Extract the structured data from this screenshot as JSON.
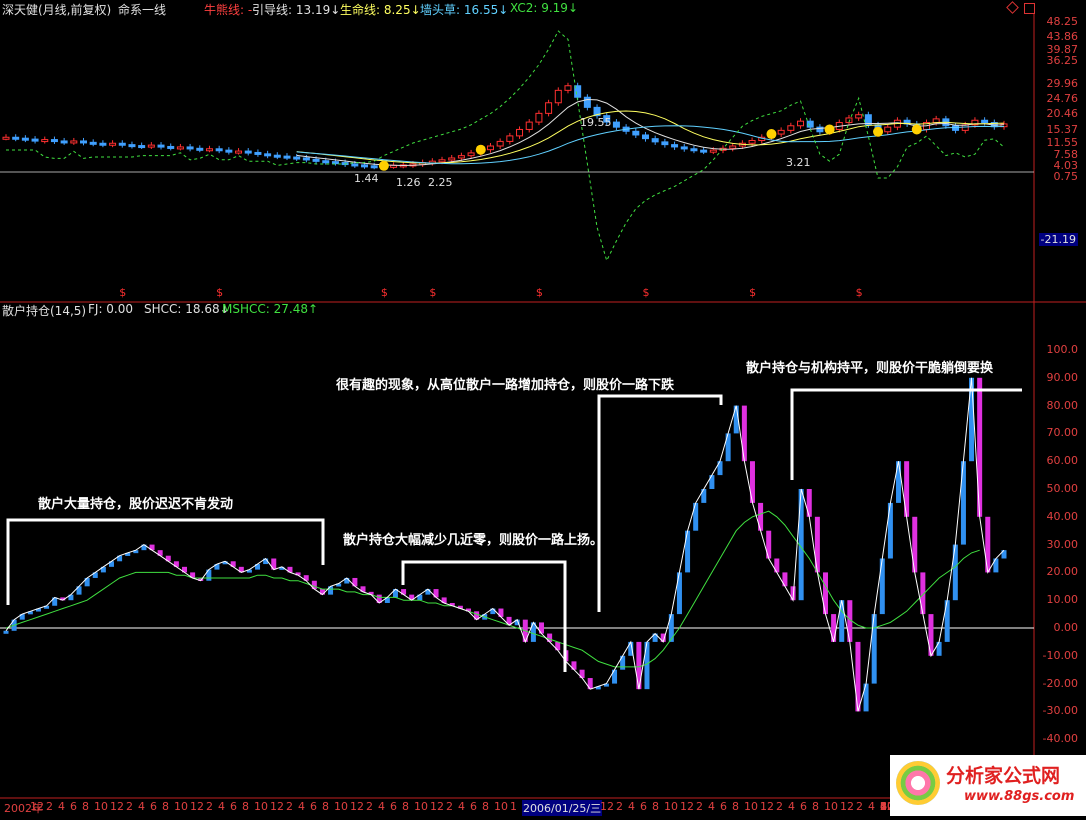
{
  "upper_header": {
    "stock": "深天健(月线,前复权)",
    "system": "命系一线",
    "items": [
      {
        "label": "牛熊线: -",
        "color": "#ff4040"
      },
      {
        "label": "引导线: 13.19↓",
        "color": "#e0e0e0"
      },
      {
        "label": "生命线: 8.25↓",
        "color": "#ffff60"
      },
      {
        "label": "墙头草: 16.55↓",
        "color": "#60d0ff"
      },
      {
        "label": "XC2: 9.19↓",
        "color": "#40e040"
      }
    ]
  },
  "lower_header": {
    "items": [
      {
        "label": "散户持仓(14,5)",
        "color": "#e0e0e0"
      },
      {
        "label": "FJ: 0.00",
        "color": "#e0e0e0"
      },
      {
        "label": "SHCC: 18.68↓",
        "color": "#e0e0e0"
      },
      {
        "label": "MSHCC: 27.48↑",
        "color": "#40e040"
      }
    ]
  },
  "annotations": [
    {
      "text": "散户大量持仓，股价迟迟不肯发动"
    },
    {
      "text": "散户持仓大幅减少几近零，则股价一路上扬。"
    },
    {
      "text": "很有趣的现象，从高位散户一路增加持仓，则股价一路下跌"
    },
    {
      "text": "散户持仓与机构持平，则股价干脆躺倒要换"
    }
  ],
  "x_axis": {
    "labels": [
      "2002年",
      "12",
      "2",
      "4",
      "6",
      "8",
      "10",
      "12",
      "2",
      "4",
      "6",
      "8",
      "10",
      "12",
      "2",
      "4",
      "6",
      "8",
      "10",
      "12",
      "2",
      "4",
      "6",
      "8",
      "10",
      "12",
      "2",
      "4",
      "6",
      "8",
      "10",
      "12",
      "2",
      "4",
      "6",
      "8",
      "10",
      "1",
      "2006/01/25/三",
      "12",
      "2",
      "4",
      "6",
      "8",
      "10",
      "12",
      "2",
      "4",
      "6",
      "8",
      "10",
      "12",
      "2",
      "4",
      "6",
      "8",
      "10",
      "12",
      "2",
      "4",
      "6",
      "8",
      "10",
      "12",
      "2",
      "4",
      "6",
      "8",
      "10",
      "12",
      "2",
      "4"
    ],
    "highlight": "2006/01/25/三"
  },
  "logo": {
    "title": "分析家公式网",
    "url": "www.88gs.com"
  },
  "chart_data": [
    {
      "type": "candlestick",
      "title": "深天健(月线,前复权)",
      "ylabels": [
        "48.25",
        "43.86",
        "39.87",
        "36.25",
        "29.96",
        "24.76",
        "20.46",
        "15.37",
        "11.55",
        "7.58",
        "4.03",
        "0.75",
        "-21.19"
      ],
      "price_labels": [
        "19.55",
        "1.44",
        "1.26",
        "2.25",
        "3.21"
      ],
      "series": [
        {
          "name": "引导线",
          "color": "#e0e0e0"
        },
        {
          "name": "生命线",
          "color": "#ffff60"
        },
        {
          "name": "墙头草",
          "color": "#60d0ff"
        },
        {
          "name": "XC2",
          "color": "#40e040"
        }
      ],
      "closes": [
        8.3,
        8.1,
        7.9,
        7.6,
        7.8,
        7.5,
        7.3,
        7.5,
        7.2,
        7.0,
        6.8,
        7.0,
        6.7,
        6.5,
        6.4,
        6.6,
        6.3,
        6.1,
        6.2,
        5.9,
        5.7,
        5.8,
        5.5,
        5.2,
        5.3,
        5.0,
        4.7,
        4.4,
        4.2,
        4.0,
        3.8,
        3.5,
        3.2,
        3.0,
        2.8,
        2.5,
        2.3,
        2.1,
        2.0,
        2.1,
        2.2,
        2.3,
        2.5,
        2.8,
        3.1,
        3.4,
        3.8,
        4.3,
        4.9,
        5.6,
        6.4,
        7.4,
        8.6,
        10.0,
        11.6,
        13.5,
        15.8,
        18.5,
        19.5,
        17.0,
        14.8,
        13.0,
        11.6,
        10.5,
        9.6,
        8.8,
        8.0,
        7.3,
        6.7,
        6.2,
        5.8,
        5.5,
        5.3,
        5.5,
        5.9,
        6.4,
        7.0,
        7.6,
        8.3,
        9.0,
        9.8,
        10.8,
        11.8,
        10.5,
        9.5,
        10.0,
        11.5,
        12.5,
        13.2,
        11.0,
        9.5,
        10.5,
        12.0,
        11.2,
        10.0,
        11.5,
        12.3,
        10.8,
        9.8,
        11.0,
        12.0,
        11.5,
        10.6,
        11.2
      ]
    },
    {
      "type": "bar",
      "title": "散户持仓(14,5)",
      "ylabels": [
        "100.0",
        "90.00",
        "80.00",
        "70.00",
        "60.00",
        "50.00",
        "40.00",
        "30.00",
        "20.00",
        "10.00",
        "0.00",
        "-10.00",
        "-20.00",
        "-30.00",
        "-40.00"
      ],
      "ylim": [
        -47,
        113
      ],
      "series": [
        {
          "name": "SHCC",
          "color": "#ffffff",
          "values": [
            -1,
            3,
            5,
            6,
            7,
            8,
            11,
            10,
            12,
            15,
            18,
            20,
            22,
            24,
            26,
            27,
            28,
            30,
            28,
            26,
            24,
            22,
            20,
            18,
            17,
            21,
            23,
            24,
            22,
            20,
            21,
            23,
            25,
            21,
            22,
            20,
            19,
            17,
            14,
            12,
            15,
            16,
            18,
            15,
            13,
            12,
            9,
            11,
            14,
            12,
            10,
            12,
            14,
            11,
            9,
            8,
            7,
            6,
            3,
            5,
            7,
            4,
            1,
            3,
            -5,
            2,
            -2,
            -5,
            -8,
            -12,
            -15,
            -18,
            -22,
            -21,
            -20,
            -15,
            -10,
            -5,
            -22,
            -5,
            -2,
            -5,
            5,
            20,
            35,
            45,
            50,
            55,
            60,
            70,
            80,
            60,
            45,
            35,
            25,
            20,
            15,
            10,
            50,
            40,
            20,
            5,
            -5,
            10,
            -5,
            -30,
            -20,
            5,
            25,
            45,
            60,
            40,
            20,
            5,
            -10,
            -5,
            10,
            30,
            60,
            90,
            40,
            20,
            25,
            28
          ]
        },
        {
          "name": "MSHCC",
          "color": "#40e040",
          "values": [
            0,
            1,
            2,
            3,
            4,
            5,
            6,
            7,
            8,
            9,
            10,
            12,
            14,
            16,
            18,
            19,
            20,
            20,
            20,
            20,
            20,
            19,
            19,
            18,
            18,
            18,
            18,
            18,
            18,
            18,
            18,
            19,
            19,
            18,
            18,
            17,
            17,
            16,
            15,
            14,
            14,
            14,
            13,
            13,
            12,
            12,
            11,
            11,
            11,
            10,
            10,
            10,
            9,
            9,
            8,
            8,
            7,
            6,
            5,
            4,
            3,
            2,
            1,
            0,
            -1,
            -2,
            -3,
            -4,
            -5,
            -6,
            -7,
            -8,
            -10,
            -12,
            -13,
            -14,
            -14,
            -14,
            -14,
            -13,
            -11,
            -8,
            -4,
            0,
            5,
            10,
            15,
            20,
            25,
            30,
            35,
            38,
            40,
            41,
            42,
            40,
            37,
            33,
            29,
            25,
            20,
            15,
            10,
            6,
            3,
            1,
            0,
            0,
            1,
            2,
            4,
            6,
            9,
            12,
            15,
            18,
            20,
            22,
            25,
            27,
            28
          ]
        }
      ]
    }
  ]
}
